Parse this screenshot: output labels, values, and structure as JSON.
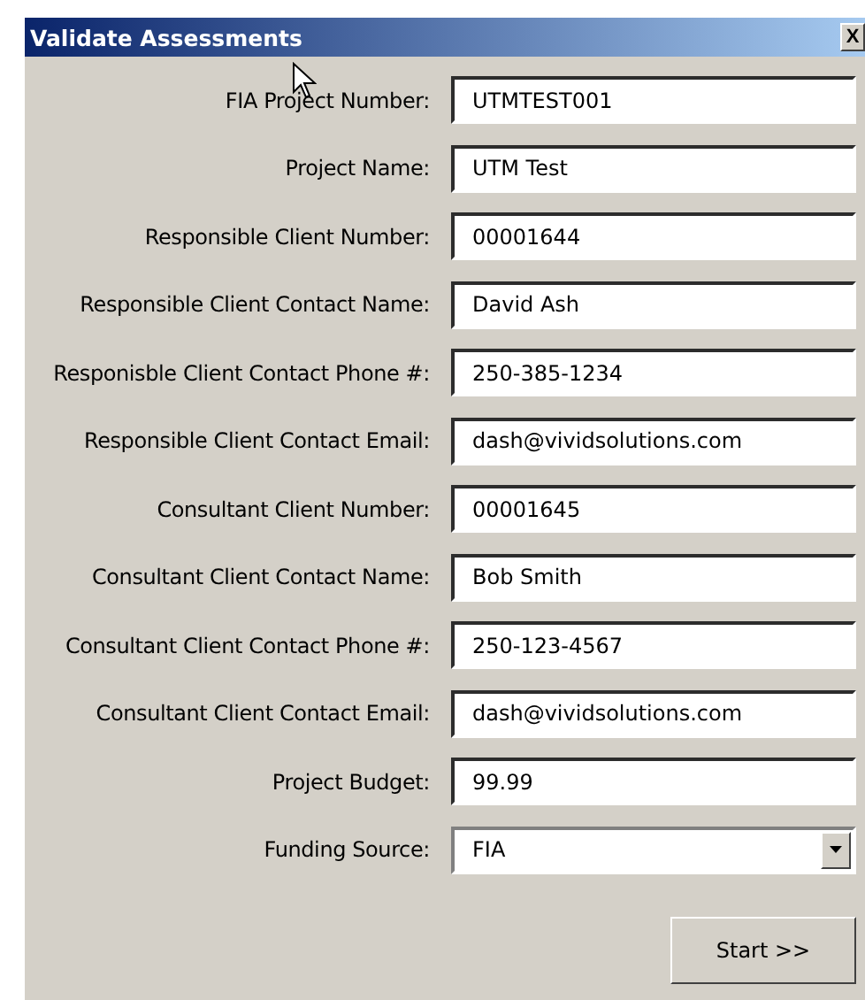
{
  "window": {
    "title": "Validate Assessments",
    "close": "X"
  },
  "fields": [
    {
      "kind": "text",
      "label": "FIA Project Number:",
      "value": "UTMTEST001"
    },
    {
      "kind": "text",
      "label": "Project Name:",
      "value": "UTM Test"
    },
    {
      "kind": "text",
      "label": "Responsible Client Number:",
      "value": "00001644"
    },
    {
      "kind": "text",
      "label": "Responsible Client Contact Name:",
      "value": "David Ash"
    },
    {
      "kind": "text",
      "label": "Responisble Client Contact Phone #:",
      "value": "250-385-1234"
    },
    {
      "kind": "text",
      "label": "Responsible Client Contact Email:",
      "value": "dash@vividsolutions.com"
    },
    {
      "kind": "text",
      "label": "Consultant Client Number:",
      "value": "00001645"
    },
    {
      "kind": "text",
      "label": "Consultant Client Contact Name:",
      "value": "Bob Smith"
    },
    {
      "kind": "text",
      "label": "Consultant Client Contact Phone #:",
      "value": "250-123-4567"
    },
    {
      "kind": "text",
      "label": "Consultant Client Contact Email:",
      "value": "dash@vividsolutions.com"
    },
    {
      "kind": "text",
      "label": "Project Budget:",
      "value": "99.99"
    },
    {
      "kind": "select",
      "label": "Funding Source:",
      "value": "FIA"
    }
  ],
  "buttons": [
    {
      "label": "Start >>"
    }
  ]
}
